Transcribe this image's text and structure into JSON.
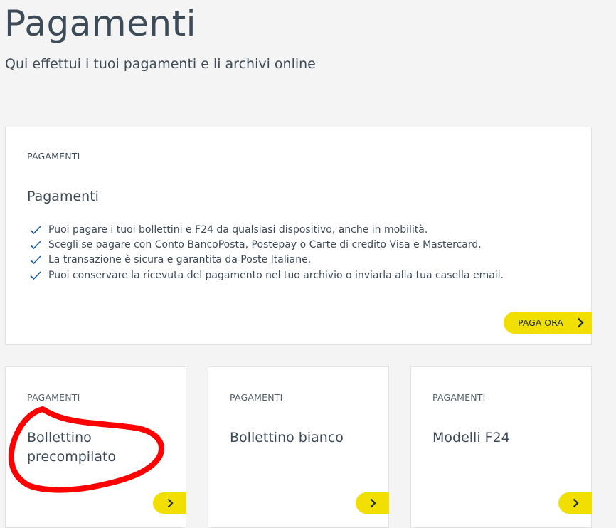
{
  "header": {
    "title": "Pagamenti",
    "subtitle": "Qui effettui i tuoi pagamenti e li archivi online"
  },
  "main_card": {
    "category": "PAGAMENTI",
    "title": "Pagamenti",
    "features": [
      "Puoi pagare i tuoi bollettini e F24 da qualsiasi dispositivo, anche in mobilità.",
      "Scegli se pagare con Conto BancoPosta, Postepay o Carte di credito Visa e Mastercard.",
      "La transazione è sicura e garantita da Poste Italiane.",
      "Puoi conservare la ricevuta del pagamento nel tuo archivio o inviarla alla tua casella email."
    ],
    "cta_label": "PAGA ORA"
  },
  "cards": [
    {
      "category": "PAGAMENTI",
      "title": "Bollettino precompilato"
    },
    {
      "category": "PAGAMENTI",
      "title": "Bollettino bianco"
    },
    {
      "category": "PAGAMENTI",
      "title": "Modelli F24"
    }
  ],
  "colors": {
    "accent": "#f0df00",
    "check": "#1a5ca8",
    "annotation": "#ff0000",
    "background": "#f4f4f4"
  }
}
